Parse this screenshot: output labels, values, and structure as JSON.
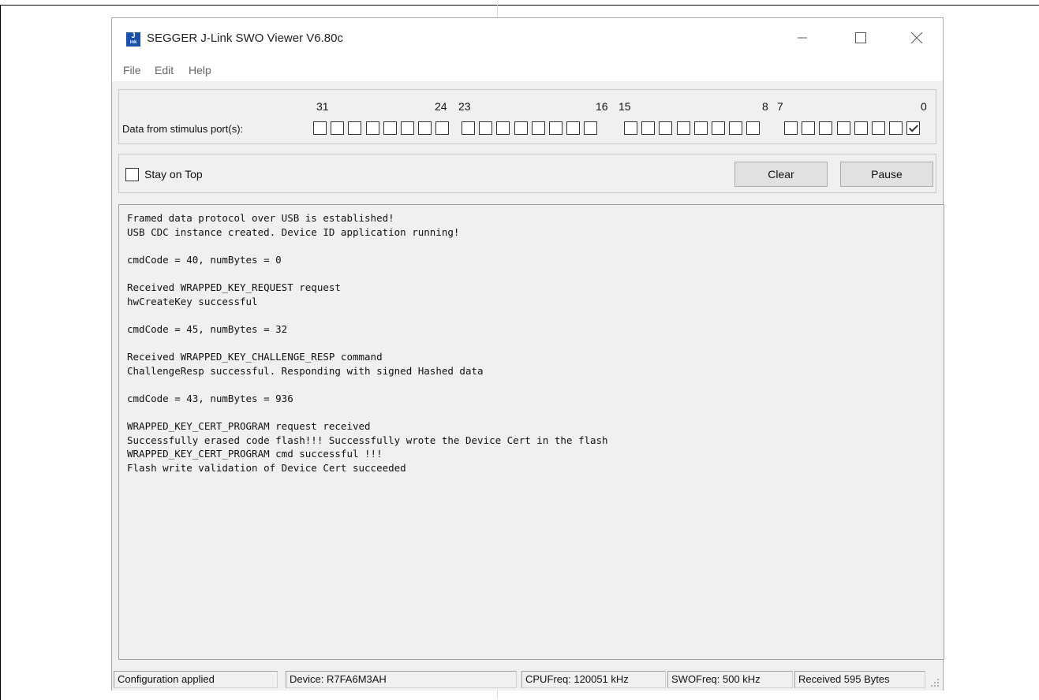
{
  "window": {
    "title": "SEGGER J-Link SWO Viewer V6.80c",
    "icon_text_top": "J",
    "icon_text_bottom": "ink",
    "controls": [
      "minimize-icon",
      "maximize-icon",
      "close-icon"
    ]
  },
  "menu": {
    "items": [
      "File",
      "Edit",
      "Help"
    ]
  },
  "ports": {
    "caption": "Data from stimulus port(s):",
    "bit_labels": [
      "31",
      "24",
      "23",
      "16",
      "15",
      "8",
      "7",
      "0"
    ],
    "checked": [
      false,
      false,
      false,
      false,
      false,
      false,
      false,
      false,
      false,
      false,
      false,
      false,
      false,
      false,
      false,
      false,
      false,
      false,
      false,
      false,
      false,
      false,
      false,
      false,
      false,
      false,
      false,
      false,
      false,
      false,
      false,
      true
    ]
  },
  "controls": {
    "stay_on_top_label": "Stay on Top",
    "stay_on_top_checked": false,
    "clear_label": "Clear",
    "pause_label": "Pause"
  },
  "log": {
    "lines": [
      "Framed data protocol over USB is established!",
      "USB CDC instance created. Device ID application running!",
      "",
      "cmdCode = 40, numBytes = 0",
      "",
      "Received WRAPPED_KEY_REQUEST request",
      "hwCreateKey successful",
      "",
      "cmdCode = 45, numBytes = 32",
      "",
      "Received WRAPPED_KEY_CHALLENGE_RESP command",
      "ChallengeResp successful. Responding with signed Hashed data",
      "",
      "cmdCode = 43, numBytes = 936",
      "",
      "WRAPPED_KEY_CERT_PROGRAM request received",
      "Successfully erased code flash!!! Successfully wrote the Device Cert in the flash",
      "WRAPPED_KEY_CERT_PROGRAM cmd successful !!!",
      "Flash write validation of Device Cert succeeded"
    ]
  },
  "status": {
    "config": "Configuration applied",
    "device": "Device: R7FA6M3AH",
    "cpufreq": "CPUFreq: 120051 kHz",
    "swofreq": "SWOFreq: 500 kHz",
    "received": "Received 595 Bytes"
  }
}
